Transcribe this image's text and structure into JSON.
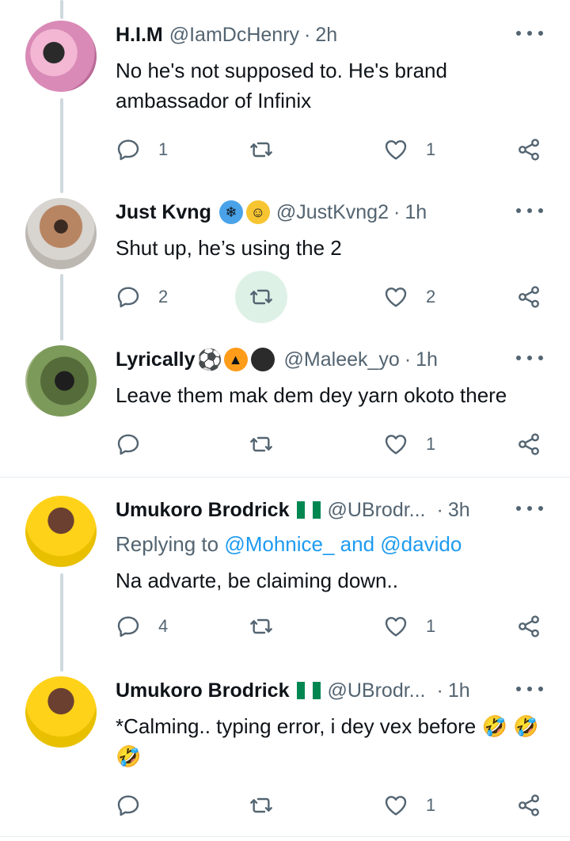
{
  "colors": {
    "text": "#0f1419",
    "muted": "#536471",
    "link": "#1d9bf0",
    "retweet_active_bg": "#def1e6",
    "thread_line": "#cfd9de"
  },
  "tweets": [
    {
      "name": "H.I.M",
      "handle": "@IamDcHenry",
      "time": "2h",
      "text": "No he's not supposed to. He's brand ambassador of Infinix",
      "replies": "1",
      "retweets": "",
      "likes": "1"
    },
    {
      "name": "Just Kvng",
      "name_emojis": [
        "cold-face-emoji",
        "drooling-face-emoji"
      ],
      "handle": "@JustKvng2",
      "time": "1h",
      "text": "Shut up, he’s using the 2",
      "replies": "2",
      "retweets": "",
      "likes": "2"
    },
    {
      "name": "Lyrically",
      "name_emojis": [
        "soccer-ball-emoji",
        "fire-emoji",
        "bomb-emoji"
      ],
      "handle": "@Maleek_yo",
      "time": "1h",
      "text": "Leave them mak dem dey yarn okoto there",
      "replies": "",
      "retweets": "",
      "likes": "1"
    },
    {
      "name": "Umukoro Brodrick",
      "flag": "nigeria-flag",
      "handle": "@UBrodr...",
      "time": "3h",
      "replying_prefix": "Replying to ",
      "replying_to": "@Mohnice_ and @davido",
      "text": "Na advarte, be claiming down..",
      "replies": "4",
      "retweets": "",
      "likes": "1"
    },
    {
      "name": "Umukoro Brodrick",
      "flag": "nigeria-flag",
      "handle": "@UBrodr...",
      "time": "1h",
      "text": "*Calming.. typing error, i dey vex before 🤣 🤣🤣",
      "replies": "",
      "retweets": "",
      "likes": "1"
    }
  ],
  "separator": "·"
}
